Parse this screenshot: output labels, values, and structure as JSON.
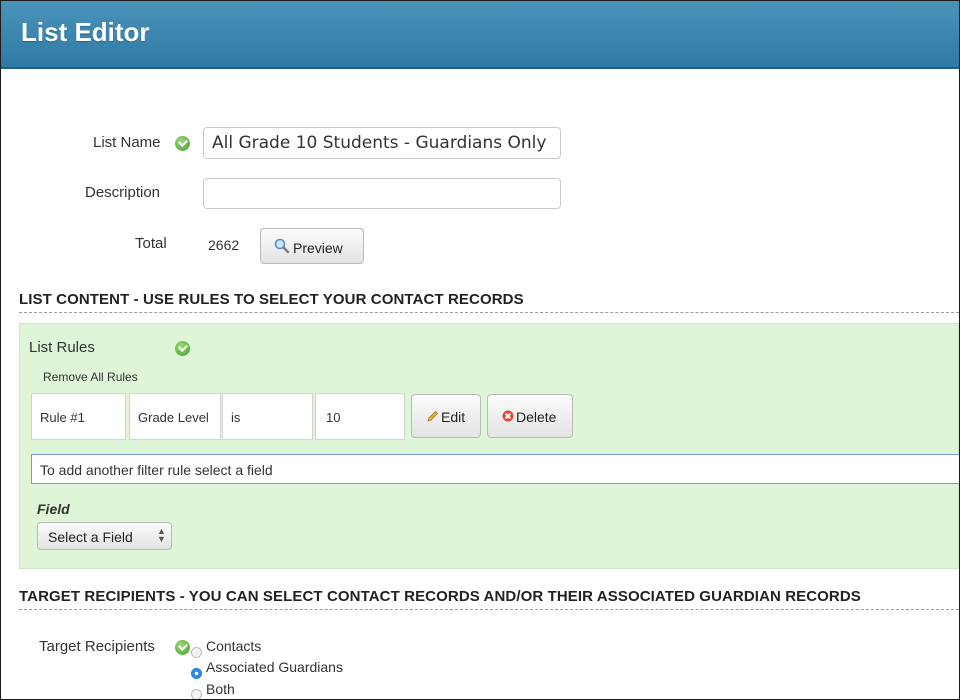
{
  "window": {
    "title": "List Editor"
  },
  "form": {
    "list_name_label": "List Name",
    "list_name_value": "All Grade 10 Students - Guardians Only",
    "description_label": "Description",
    "description_value": "",
    "total_label": "Total",
    "total_value": "2662",
    "preview_button": "Preview"
  },
  "list_content": {
    "heading": "LIST CONTENT - USE RULES TO SELECT YOUR CONTACT RECORDS",
    "rules_title": "List Rules",
    "remove_all_link": "Remove All Rules",
    "rules": [
      {
        "number": "Rule #1",
        "field": "Grade Level",
        "operator": "is",
        "value": "10"
      }
    ],
    "edit_button": "Edit",
    "delete_button": "Delete",
    "add_rule_prompt": "To add another filter rule select a field",
    "field_label": "Field",
    "field_select_value": "Select a Field"
  },
  "target_recipients": {
    "heading": "TARGET RECIPIENTS - YOU CAN SELECT CONTACT RECORDS AND/OR THEIR ASSOCIATED GUARDIAN RECORDS",
    "label": "Target Recipients",
    "options": [
      {
        "label": "Contacts",
        "selected": false
      },
      {
        "label": "Associated Guardians",
        "selected": true
      },
      {
        "label": "Both",
        "selected": false
      }
    ]
  },
  "colors": {
    "titlebar": "#3585b1",
    "panel_bg": "#dff5d7",
    "check_green": "#4faa3a",
    "delete_red": "#e04a3a"
  },
  "icons": {
    "valid": "check-circle-icon",
    "preview": "magnifier-icon",
    "edit": "pencil-icon",
    "delete": "x-icon",
    "select": "up-down-arrows-icon"
  }
}
